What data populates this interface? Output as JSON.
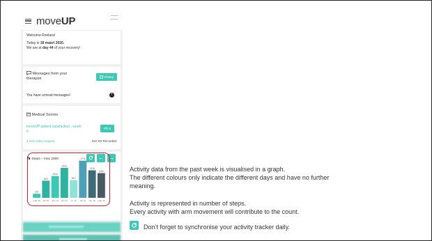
{
  "app": {
    "logo_light": "move",
    "logo_bold": "UP"
  },
  "welcome": {
    "greeting": "Welcome Roeland",
    "today_prefix": "Today is ",
    "date": "18 maart 2020.",
    "day_prefix": "We are at ",
    "day": "day 44",
    "day_suffix": " of your recovery!"
  },
  "messages": {
    "title": "Messages from your therapist",
    "history_button": "History",
    "unread": "You have unread messages!",
    "unread_badge": "!"
  },
  "medical": {
    "title": "Medical Scores",
    "survey": "moveUP patient satisfaction - week 6",
    "fill_button": "Fill in",
    "video_request": "1 new video request",
    "status": "Not Yet Recorded"
  },
  "steps": {
    "title": "Steps – max 2000"
  },
  "chart_data": {
    "type": "bar",
    "categories": [
      "maa. 09",
      "din. 10",
      "woe. 11",
      "don. 12",
      "vri. 13",
      "zat. 14",
      "zon. 15",
      "maa. 16"
    ],
    "values": [
      192,
      819,
      1044,
      1433,
      847,
      1776,
      1316,
      1184
    ],
    "value_labels": [
      "192",
      "819",
      "1044",
      "1433",
      "847",
      "1776",
      "1316",
      "1184"
    ],
    "ylim": [
      0,
      2000
    ],
    "colors": [
      "#3cc8b4",
      "#2fb3a1",
      "#3cc8b4",
      "#2fb3a1",
      "#8fe3d6",
      "#4fa0b6",
      "#3f6a78",
      "#4a5a63"
    ]
  },
  "notes": {
    "p1_line1": "Activity data from the past week is visualised in a graph.",
    "p1_line2": "The different colours only indicate the different days and have no further",
    "p1_line3": "meaning.",
    "p2_line1": "Activity is represented in number of steps.",
    "p2_line2": "Every activity with arm movement will contribute to the count.",
    "p3": "Don’t forget to synchronise your activity tracker daily."
  },
  "colors": {
    "accent": "#3cc8b4",
    "highlight": "#d61c2a"
  }
}
